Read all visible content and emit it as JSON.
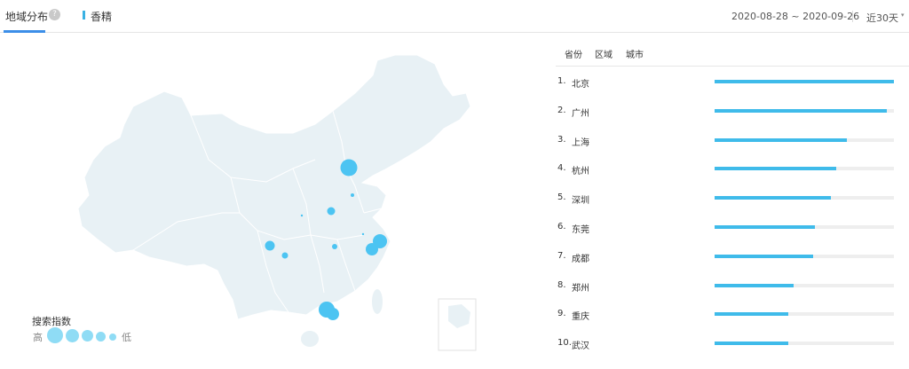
{
  "header": {
    "tab_title": "地域分布",
    "help_icon": "?",
    "keyword": "香精",
    "date_range": "2020-08-28 ~ 2020-09-26",
    "period": "近30天",
    "chevron": "▾"
  },
  "legend": {
    "title": "搜索指数",
    "high": "高",
    "low": "低"
  },
  "subtabs": [
    "省份",
    "区域",
    "城市"
  ],
  "ranking": [
    {
      "num": "1.",
      "name": "北京",
      "pct": 100
    },
    {
      "num": "2.",
      "name": "广州",
      "pct": 96
    },
    {
      "num": "3.",
      "name": "上海",
      "pct": 74
    },
    {
      "num": "4.",
      "name": "杭州",
      "pct": 68
    },
    {
      "num": "5.",
      "name": "深圳",
      "pct": 65
    },
    {
      "num": "6.",
      "name": "东莞",
      "pct": 56
    },
    {
      "num": "7.",
      "name": "成都",
      "pct": 55
    },
    {
      "num": "8.",
      "name": "郑州",
      "pct": 44
    },
    {
      "num": "9.",
      "name": "重庆",
      "pct": 41
    },
    {
      "num": "10.",
      "name": "武汉",
      "pct": 41
    }
  ],
  "colors": {
    "accent": "#3c8ee8",
    "bar": "#3fbbea",
    "map_fill": "#e8f1f5",
    "bubble": "#4cc4f2"
  }
}
